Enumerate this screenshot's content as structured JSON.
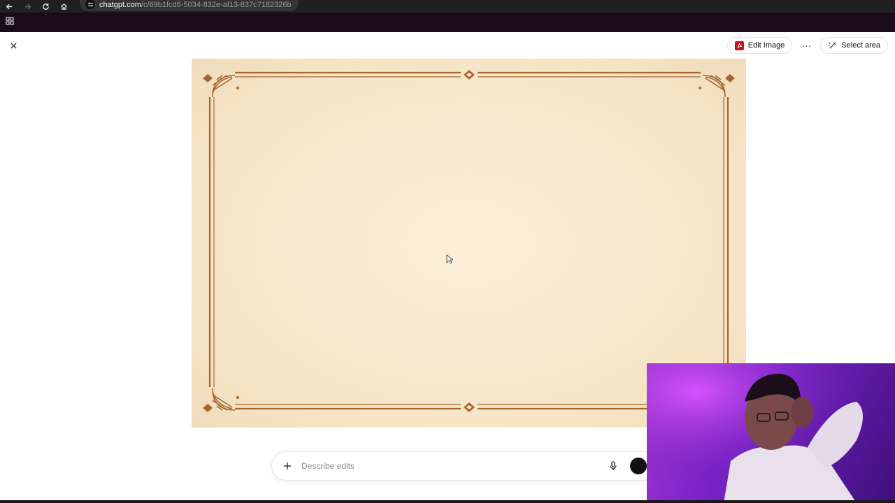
{
  "browser": {
    "url_domain": "chatgpt.com",
    "url_path": "/c/69b1fcd6-5034-832e-af13-837c7182326b"
  },
  "toolbar": {
    "edit_image_label": "Edit Image",
    "more_label": "···",
    "select_area_label": "Select area"
  },
  "prompt": {
    "placeholder": "Describe edits"
  },
  "colors": {
    "border_brown": "#a5672f",
    "parchment": "#f8e9cf",
    "pdf_red": "#c4161c",
    "webcam_purple": "#8a2be2"
  },
  "icons": {
    "back": "arrow-left-icon",
    "forward": "arrow-right-icon",
    "reload": "reload-icon",
    "home": "home-icon",
    "apps": "apps-grid-icon",
    "close": "close-icon",
    "edit": "pdf-icon",
    "select": "select-area-icon",
    "add": "plus-icon",
    "mic": "microphone-icon"
  }
}
